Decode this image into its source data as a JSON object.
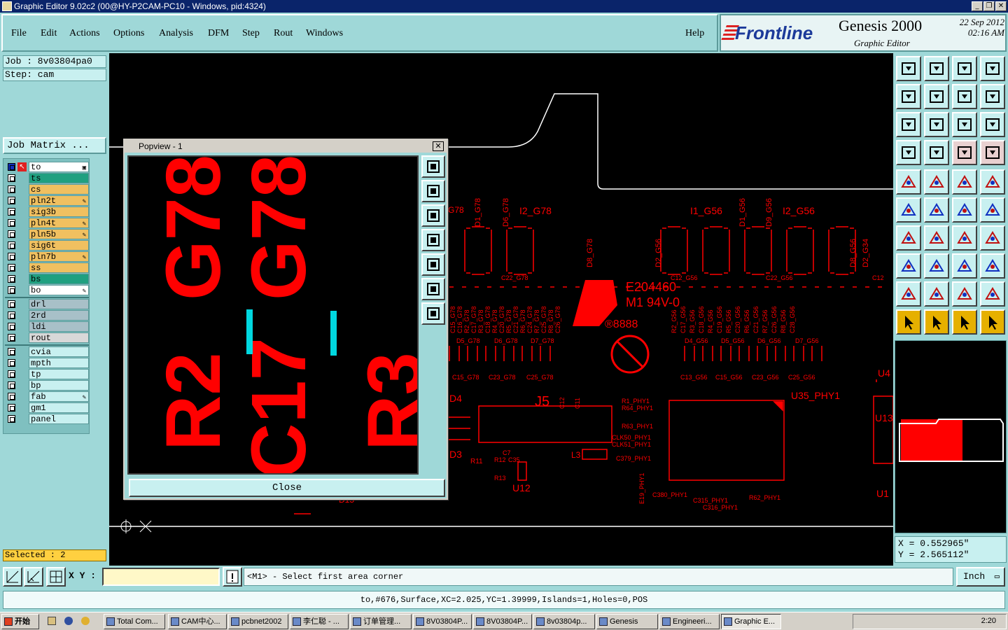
{
  "window": {
    "title": "Graphic Editor 9.02c2 (00@HY-P2CAM-PC10 - Windows, pid:4324)",
    "buttons": [
      "_",
      "❐",
      "✕"
    ]
  },
  "menu": [
    "File",
    "Edit",
    "Actions",
    "Options",
    "Analysis",
    "DFM",
    "Step",
    "Rout",
    "Windows",
    "Help"
  ],
  "brand": {
    "logo": "Frontline",
    "product": "Genesis 2000",
    "subtitle": "Graphic Editor",
    "date_line1": "22  Sep  2012",
    "date_line2": "02:16  AM"
  },
  "left": {
    "job": "Job  :  8v03804pa0",
    "step": "Step:  cam",
    "job_matrix": "Job Matrix ...",
    "layers": [
      {
        "name": "to",
        "color": "#ffffff",
        "work": true
      },
      {
        "name": "ts",
        "color": "#20a080"
      },
      {
        "name": "cs",
        "color": "#f0c060"
      },
      {
        "name": "pln2t",
        "color": "#f0c060",
        "flag": "✎"
      },
      {
        "name": "sig3b",
        "color": "#f0c060"
      },
      {
        "name": "pln4t",
        "color": "#f0c060",
        "flag": "✎"
      },
      {
        "name": "pln5b",
        "color": "#f0c060",
        "flag": "✎"
      },
      {
        "name": "sig6t",
        "color": "#f0c060"
      },
      {
        "name": "pln7b",
        "color": "#f0c060",
        "flag": "✎"
      },
      {
        "name": "ss",
        "color": "#f0c060"
      },
      {
        "name": "bs",
        "color": "#20a080"
      },
      {
        "name": "bo",
        "color": "#ffffff",
        "flag": "✎"
      }
    ],
    "drill_layers": [
      {
        "name": "drl",
        "color": "#a8c0c8"
      },
      {
        "name": "2rd",
        "color": "#a8c0c8"
      },
      {
        "name": "ldi",
        "color": "#a8c0c8"
      },
      {
        "name": "rout",
        "color": "#d8d8d8"
      }
    ],
    "misc_layers": [
      {
        "name": "cvia",
        "color": "#c8f0f0"
      },
      {
        "name": "mpth",
        "color": "#c8f0f0"
      },
      {
        "name": "tp",
        "color": "#c8f0f0"
      },
      {
        "name": "bp",
        "color": "#c8f0f0"
      },
      {
        "name": "fab",
        "color": "#c8f0f0",
        "flag": "✎"
      },
      {
        "name": "gm1",
        "color": "#c8f0f0"
      },
      {
        "name": "panel",
        "color": "#c8f0f0"
      }
    ],
    "selected": "Selected : 2"
  },
  "canvas": {
    "labels": [
      "G78",
      "D1_G78",
      "D6_G78",
      "I2_G78",
      "I1_G56",
      "D1_G56",
      "D9_G56",
      "I2_G56",
      "D8_G78",
      "D2_G56",
      "D8_G56",
      "D2_G34",
      "C22_G78",
      "C12_G56",
      "C22_G56",
      "C12",
      "E204460",
      "M1  94V-0",
      "®8888",
      "D5_G78",
      "D6_G78",
      "D7_G78",
      "D4_G56",
      "D5_G56",
      "D6_G56",
      "D7_G56",
      "C15_G78",
      "C23_G78",
      "C25_G78",
      "C13_G56",
      "C15_G56",
      "C23_G56",
      "C25_G56",
      "D4",
      "J5",
      "D3",
      "R11",
      "R13",
      "C35",
      "C7",
      "R12",
      "U12",
      "L3",
      "R1_PHY1",
      "R64_PHY1",
      "R63_PHY1",
      "CLK50_PHY1",
      "CLK51_PHY1",
      "C379_PHY1",
      "U35_PHY1",
      "U4",
      "U13",
      "U1",
      "E19_PHY1",
      "C380_PHY1",
      "C315_PHY1",
      "C316_PHY1",
      "R62_PHY1",
      "D15",
      "C12",
      "C11"
    ],
    "vert_labels_g78": [
      "C15_G78",
      "C16_G78",
      "R2_G78",
      "C17_G78",
      "R3_G78",
      "C18_G78",
      "R4_G78",
      "C20_G78",
      "R5_G78",
      "C21_G78",
      "R6_G78",
      "C24_G78",
      "R7_G78",
      "C25_G78",
      "R8_G78",
      "C26_G78"
    ],
    "vert_labels_g56": [
      "R2_G56",
      "C17_G56",
      "R3_G56",
      "C18_G56",
      "R4_G56",
      "C19_G56",
      "R5_G56",
      "C20_G56",
      "R6_G56",
      "C21_G56",
      "R7_G56",
      "C26_G56",
      "R8_G56",
      "C28_G56"
    ]
  },
  "popview": {
    "title": "Popview - 1",
    "text_left_top": "G78",
    "text_left_bottom": "R2",
    "text_mid_top": "G78",
    "text_mid_bottom": "C17",
    "text_right": "R3",
    "close_label": "Close",
    "buttons": [
      "zoom-fit-icon",
      "pan-up-icon",
      "pan-down-icon",
      "pan-left-icon",
      "pan-right-icon",
      "zoom-in-icon",
      "zoom-out-icon"
    ]
  },
  "right": {
    "coord_x": "X  =  0.552965\"",
    "coord_y": "Y  =  2.565112\""
  },
  "bottom": {
    "xy_label": "X Y :",
    "xy_value": "",
    "prompt": "<M1> - Select first area corner",
    "unit": "Inch",
    "status": "to,#676,Surface,XC=2.025,YC=1.39999,Islands=1,Holes=0,POS"
  },
  "taskbar": {
    "start": "开始",
    "tasks": [
      "Total Com...",
      "CAM中心...",
      "pcbnet2002",
      "李仁聪 - ...",
      "订单管理...",
      "8V03804P...",
      "8V03804P...",
      "8v03804p...",
      "Genesis",
      "Engineeri...",
      "Graphic E..."
    ],
    "clock": "2:20"
  }
}
